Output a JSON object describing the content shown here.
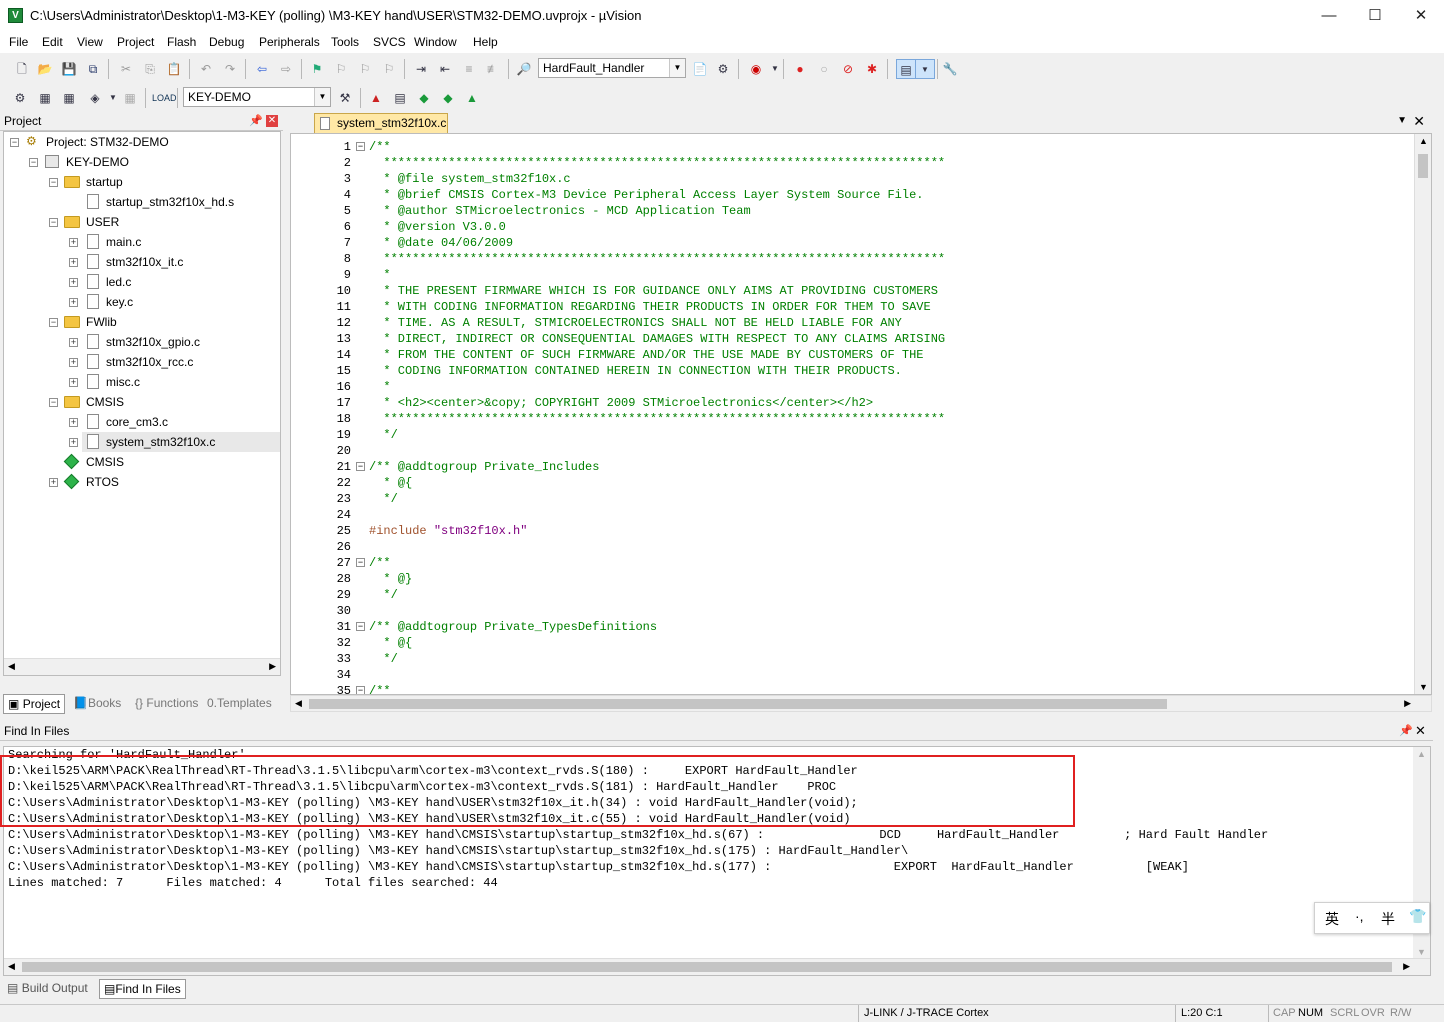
{
  "window": {
    "title": "C:\\Users\\Administrator\\Desktop\\1-M3-KEY  (polling)  \\M3-KEY hand\\USER\\STM32-DEMO.uvprojx - µVision",
    "controls": {
      "minimize": "—",
      "maximize": "☐",
      "close": "✕"
    }
  },
  "menu": [
    "File",
    "Edit",
    "View",
    "Project",
    "Flash",
    "Debug",
    "Peripherals",
    "Tools",
    "SVCS",
    "Window",
    "Help"
  ],
  "toolbar": {
    "find_combo": "HardFault_Handler",
    "target_combo": "KEY-DEMO"
  },
  "project_panel": {
    "title": "Project",
    "root": "Project: STM32-DEMO",
    "target": "KEY-DEMO",
    "groups": [
      {
        "name": "startup",
        "files": [
          "startup_stm32f10x_hd.s"
        ]
      },
      {
        "name": "USER",
        "files": [
          "main.c",
          "stm32f10x_it.c",
          "led.c",
          "key.c"
        ]
      },
      {
        "name": "FWlib",
        "files": [
          "stm32f10x_gpio.c",
          "stm32f10x_rcc.c",
          "misc.c"
        ]
      },
      {
        "name": "CMSIS",
        "files": [
          "core_cm3.c",
          "system_stm32f10x.c"
        ]
      }
    ],
    "components": [
      "CMSIS",
      "RTOS"
    ],
    "tabs": [
      "Project",
      "Books",
      "Functions",
      "Templates"
    ]
  },
  "editor": {
    "tab": "system_stm32f10x.c",
    "lines": [
      "/**",
      "  ******************************************************************************",
      "  * @file system_stm32f10x.c",
      "  * @brief CMSIS Cortex-M3 Device Peripheral Access Layer System Source File.",
      "  * @author STMicroelectronics - MCD Application Team",
      "  * @version V3.0.0",
      "  * @date 04/06/2009",
      "  ******************************************************************************",
      "  *",
      "  * THE PRESENT FIRMWARE WHICH IS FOR GUIDANCE ONLY AIMS AT PROVIDING CUSTOMERS",
      "  * WITH CODING INFORMATION REGARDING THEIR PRODUCTS IN ORDER FOR THEM TO SAVE",
      "  * TIME. AS A RESULT, STMICROELECTRONICS SHALL NOT BE HELD LIABLE FOR ANY",
      "  * DIRECT, INDIRECT OR CONSEQUENTIAL DAMAGES WITH RESPECT TO ANY CLAIMS ARISING",
      "  * FROM THE CONTENT OF SUCH FIRMWARE AND/OR THE USE MADE BY CUSTOMERS OF THE",
      "  * CODING INFORMATION CONTAINED HEREIN IN CONNECTION WITH THEIR PRODUCTS.",
      "  *",
      "  * <h2><center>&copy; COPYRIGHT 2009 STMicroelectronics</center></h2>",
      "  ******************************************************************************",
      "  */",
      "",
      "/** @addtogroup Private_Includes",
      "  * @{",
      "  */",
      "",
      "#include \"stm32f10x.h\"",
      "",
      "/**",
      "  * @}",
      "  */",
      "",
      "/** @addtogroup Private_TypesDefinitions",
      "  * @{",
      "  */",
      "",
      "/**"
    ]
  },
  "find_panel": {
    "title": "Find In Files",
    "lines": [
      "Searching for 'HardFault_Handler'",
      "D:\\keil525\\ARM\\PACK\\RealThread\\RT-Thread\\3.1.5\\libcpu\\arm\\cortex-m3\\context_rvds.S(180) :     EXPORT HardFault_Handler",
      "D:\\keil525\\ARM\\PACK\\RealThread\\RT-Thread\\3.1.5\\libcpu\\arm\\cortex-m3\\context_rvds.S(181) : HardFault_Handler    PROC",
      "C:\\Users\\Administrator\\Desktop\\1-M3-KEY (polling) \\M3-KEY hand\\USER\\stm32f10x_it.h(34) : void HardFault_Handler(void);",
      "C:\\Users\\Administrator\\Desktop\\1-M3-KEY (polling) \\M3-KEY hand\\USER\\stm32f10x_it.c(55) : void HardFault_Handler(void)",
      "C:\\Users\\Administrator\\Desktop\\1-M3-KEY (polling) \\M3-KEY hand\\CMSIS\\startup\\startup_stm32f10x_hd.s(67) :                DCD     HardFault_Handler         ; Hard Fault Handler",
      "C:\\Users\\Administrator\\Desktop\\1-M3-KEY (polling) \\M3-KEY hand\\CMSIS\\startup\\startup_stm32f10x_hd.s(175) : HardFault_Handler\\",
      "C:\\Users\\Administrator\\Desktop\\1-M3-KEY (polling) \\M3-KEY hand\\CMSIS\\startup\\startup_stm32f10x_hd.s(177) :                 EXPORT  HardFault_Handler          [WEAK]",
      "Lines matched: 7      Files matched: 4      Total files searched: 44"
    ],
    "tabs": [
      "Build Output",
      "Find In Files"
    ]
  },
  "ime": {
    "lang": "英",
    "punct": "·,",
    "width": "半"
  },
  "status": {
    "debugger": "J-LINK / J-TRACE Cortex",
    "position": "L:20 C:1",
    "cap": "CAP",
    "num": "NUM",
    "scrl": "SCRL",
    "ovr": "OVR",
    "rw": "R/W"
  },
  "colors": {
    "comment": "#008000",
    "preprocessor": "#a0522d",
    "string": "#800080",
    "highlight_box": "#e02020",
    "tab_active": "#ffe8a6"
  }
}
